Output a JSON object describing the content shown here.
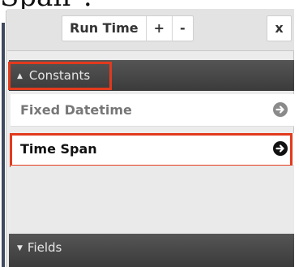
{
  "caption": "Span\".",
  "toolbar": {
    "run_time_label": "Run Time",
    "plus_label": "+",
    "minus_label": "-",
    "close_label": "x"
  },
  "constants_section": {
    "header": "Constants",
    "caret": "▲",
    "items": [
      {
        "label": "Fixed Datetime",
        "icon": "arrow-circle-right-icon",
        "icon_color": "#8a8a8a"
      },
      {
        "label": "Time Span",
        "icon": "arrow-circle-right-icon",
        "icon_color": "#111111"
      }
    ]
  },
  "fields_section": {
    "header": "Fields",
    "caret": "▼"
  },
  "colors": {
    "highlight": "#e23a1d",
    "header_bg": "#444444"
  }
}
